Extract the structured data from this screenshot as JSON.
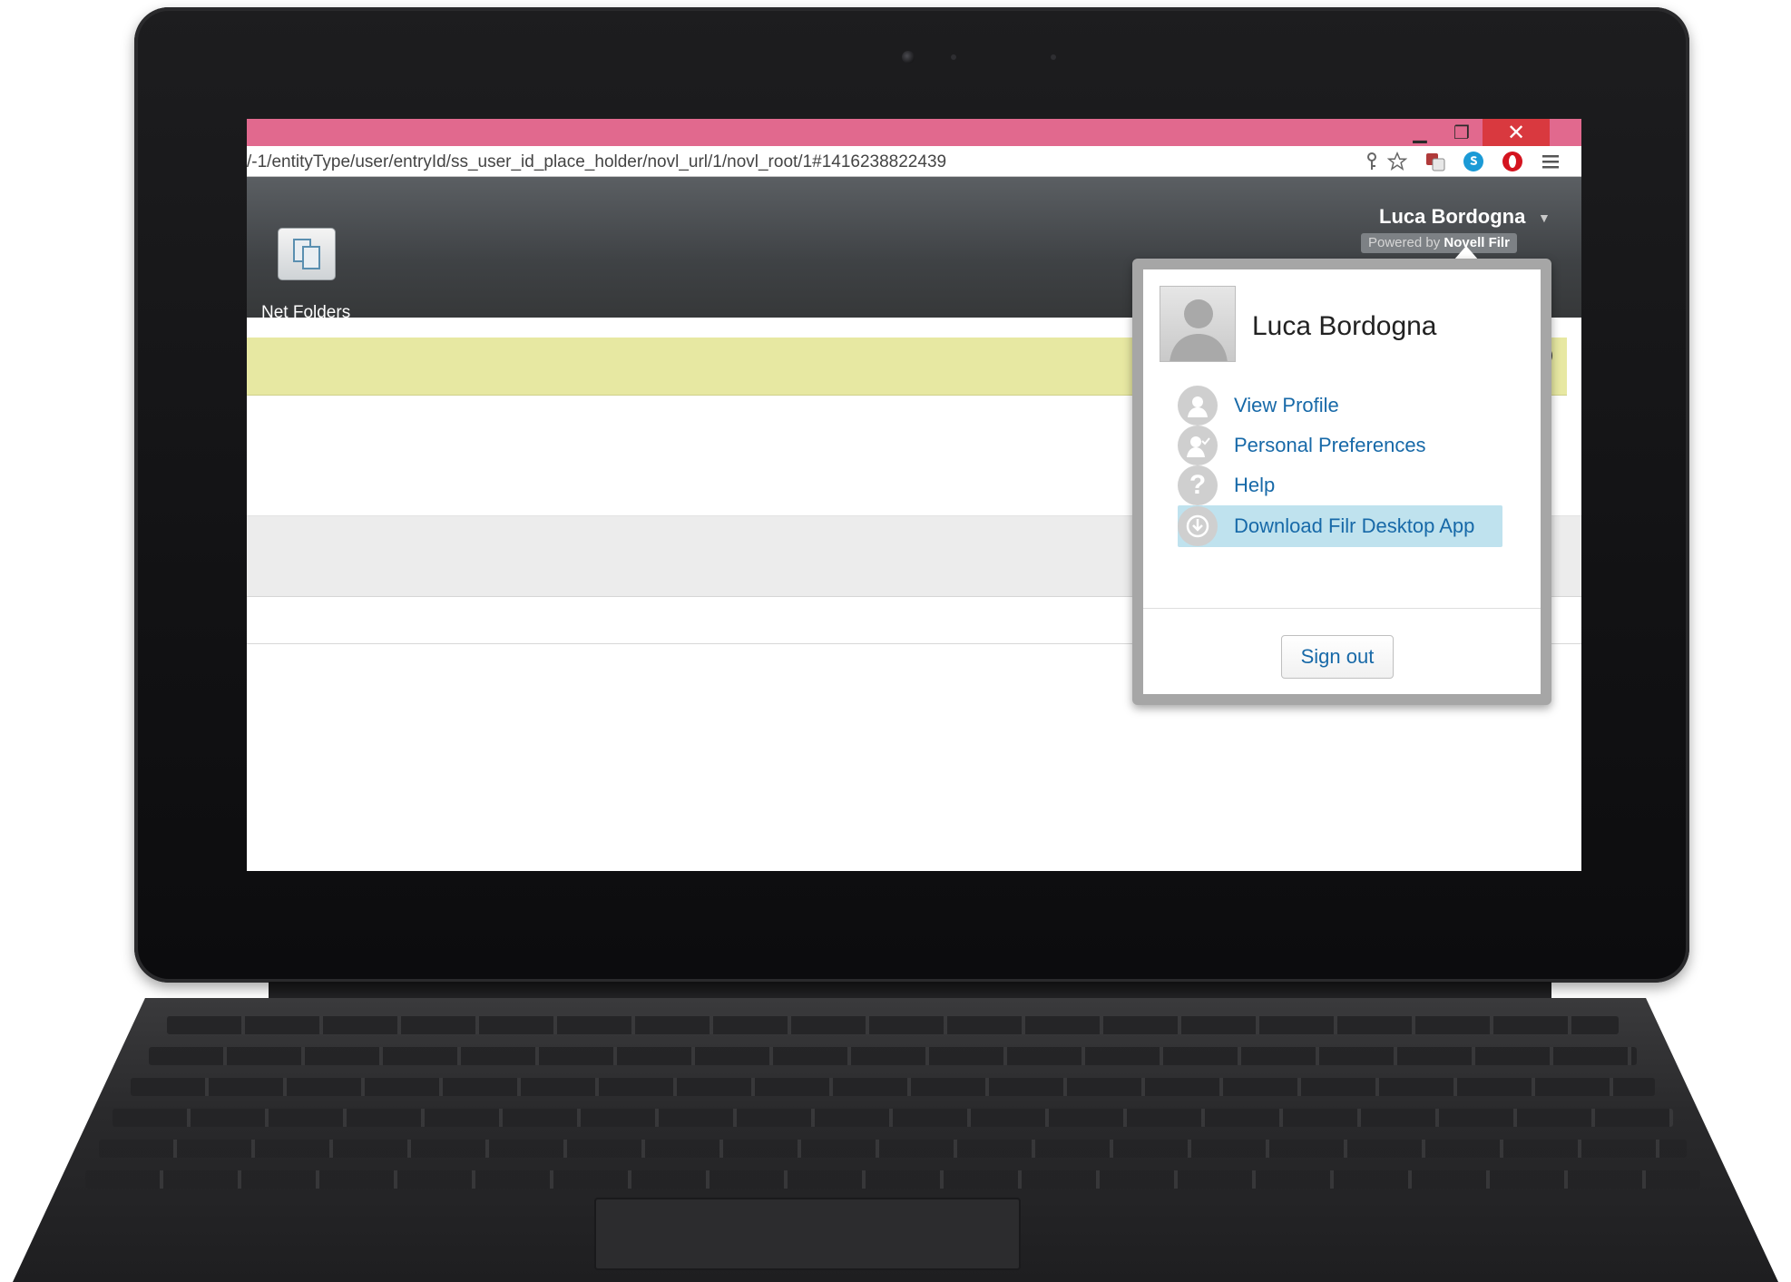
{
  "browser": {
    "url": "/-1/entityType/user/entryId/ss_user_id_place_holder/novl_url/1/novl_root/1#1416238822439",
    "titlebar_color": "#e1698e",
    "close_color": "#d9393f",
    "window_controls": {
      "minimize": "▁",
      "maximize": "❐",
      "close": "✕"
    }
  },
  "toolbar_icons": [
    "key-icon",
    "star-icon",
    "translate-icon",
    "skype-icon",
    "opera-icon",
    "menu-icon"
  ],
  "app": {
    "net_folders_label": "Net Folders",
    "user_name": "Luca Bordogna",
    "powered_by": "Powered by",
    "powered_brand": "Novell Filr"
  },
  "popup": {
    "name": "Luca Bordogna",
    "items": [
      {
        "label": "View Profile",
        "icon": "user-icon"
      },
      {
        "label": "Personal Preferences",
        "icon": "user-settings-icon"
      },
      {
        "label": "Help",
        "icon": "question-icon"
      },
      {
        "label": "Download Filr Desktop App",
        "icon": "power-download-icon",
        "active": true
      }
    ],
    "signout_label": "Sign out"
  },
  "colors": {
    "link": "#1769a8",
    "notice": "#e7e8a2",
    "active_item": "#bfe2ee"
  }
}
